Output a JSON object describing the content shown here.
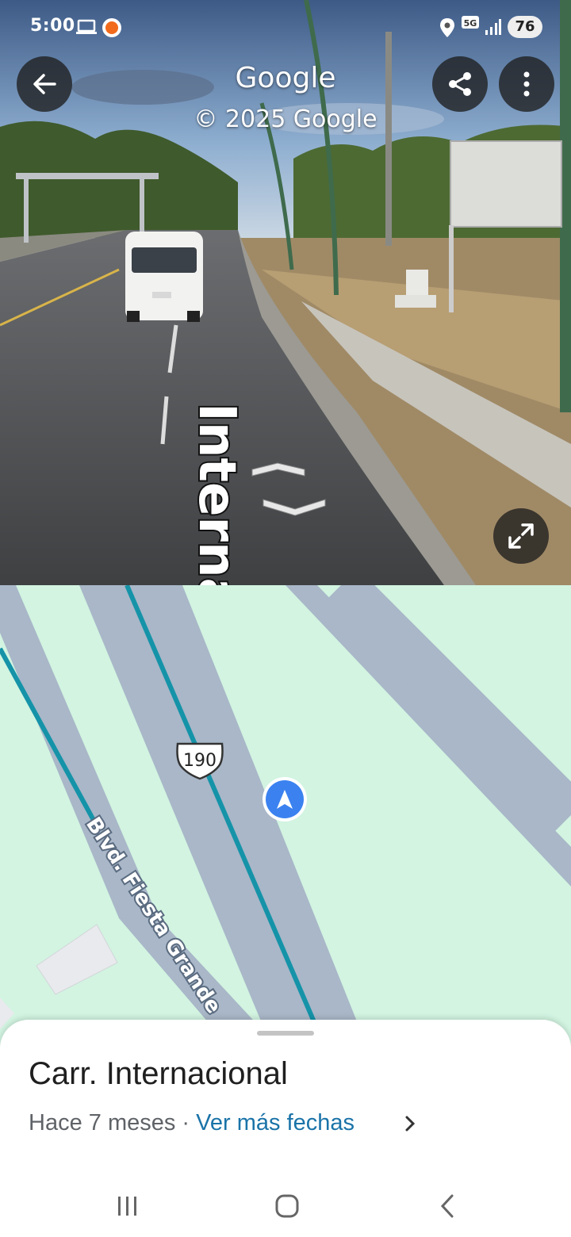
{
  "status_bar": {
    "time": "5:00",
    "network": "5G",
    "battery": "76"
  },
  "street_view": {
    "brand": "Google",
    "copyright": "© 2025 Google",
    "road_label": "Internacional",
    "icons": [
      "back-arrow-icon",
      "share-icon",
      "more-vert-icon",
      "expand-icon"
    ]
  },
  "map": {
    "shield": "190",
    "street_name": "Blvd. Fiesta Grande",
    "colors": {
      "land": "#d2f4e1",
      "road": "#a9b7c8",
      "route": "#1593a8",
      "location": "#3b82f0"
    }
  },
  "sheet": {
    "title": "Carr. Internacional",
    "time_ago": "Hace 7 meses",
    "separator": " · ",
    "more_dates": "Ver más fechas"
  },
  "nav_bar": {
    "icons": [
      "recents-icon",
      "home-icon",
      "back-icon"
    ]
  }
}
